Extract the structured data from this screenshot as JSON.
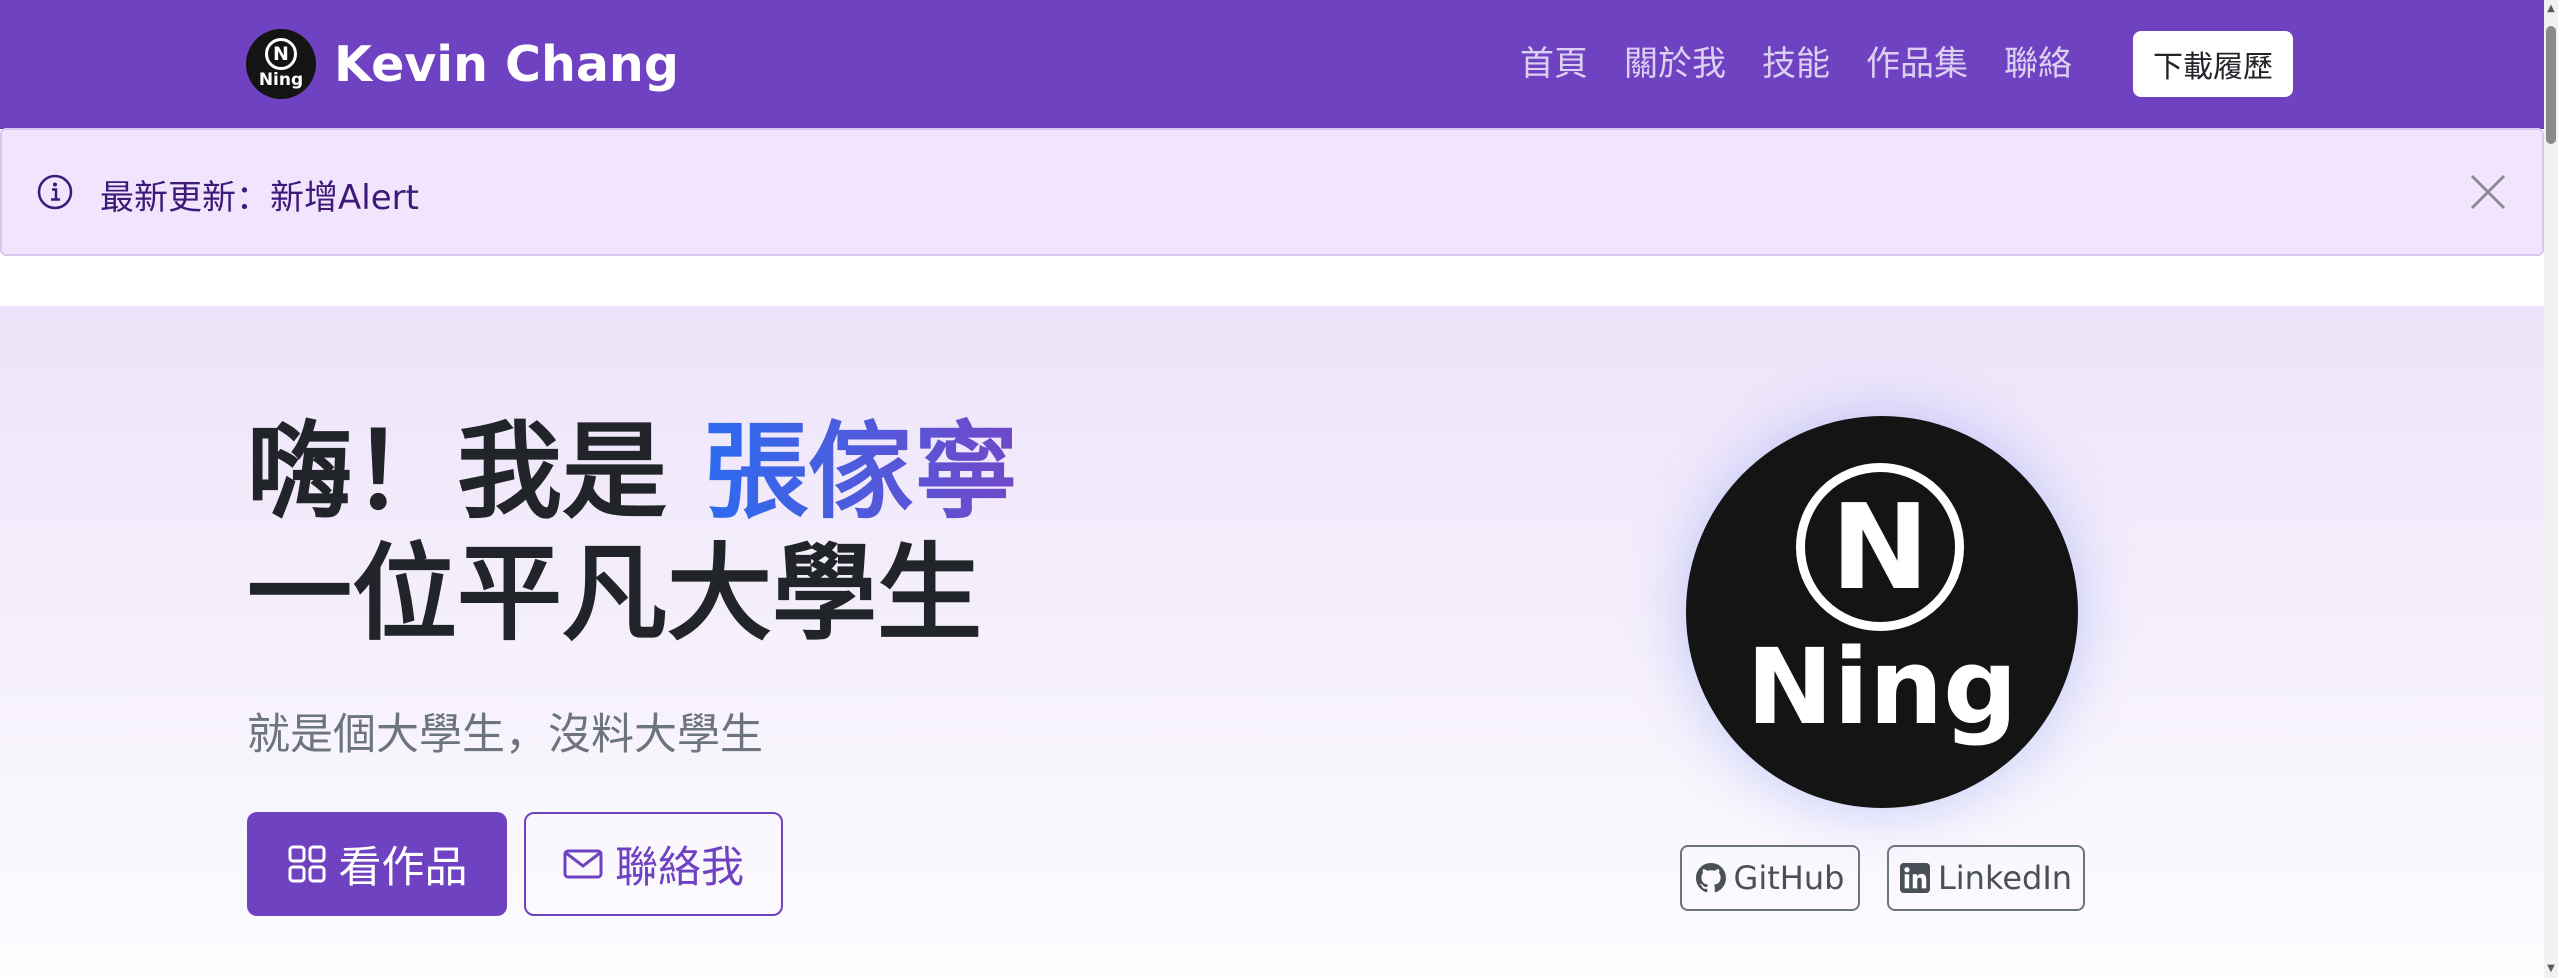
{
  "navbar": {
    "brand_logo_n": "N",
    "brand_logo_text": "Ning",
    "brand_name": "Kevin Chang",
    "links": [
      "首頁",
      "關於我",
      "技能",
      "作品集",
      "聯絡"
    ],
    "download_label": "下載履歷",
    "color": "#6f42c1"
  },
  "alert": {
    "icon": "info-circle-icon",
    "text": "最新更新：新增Alert",
    "close_icon": "close-icon"
  },
  "hero": {
    "greeting": "嗨！我是",
    "name": "張傢寧",
    "tagline": "一位平凡大學生",
    "subtitle": "就是個大學生，沒料大學生",
    "primary_button": "看作品",
    "primary_icon": "grid-icon",
    "secondary_button": "聯絡我",
    "secondary_icon": "envelope-icon",
    "avatar_n": "N",
    "avatar_text": "Ning",
    "social": [
      {
        "label": "GitHub",
        "icon": "github-icon"
      },
      {
        "label": "LinkedIn",
        "icon": "linkedin-icon"
      }
    ]
  }
}
